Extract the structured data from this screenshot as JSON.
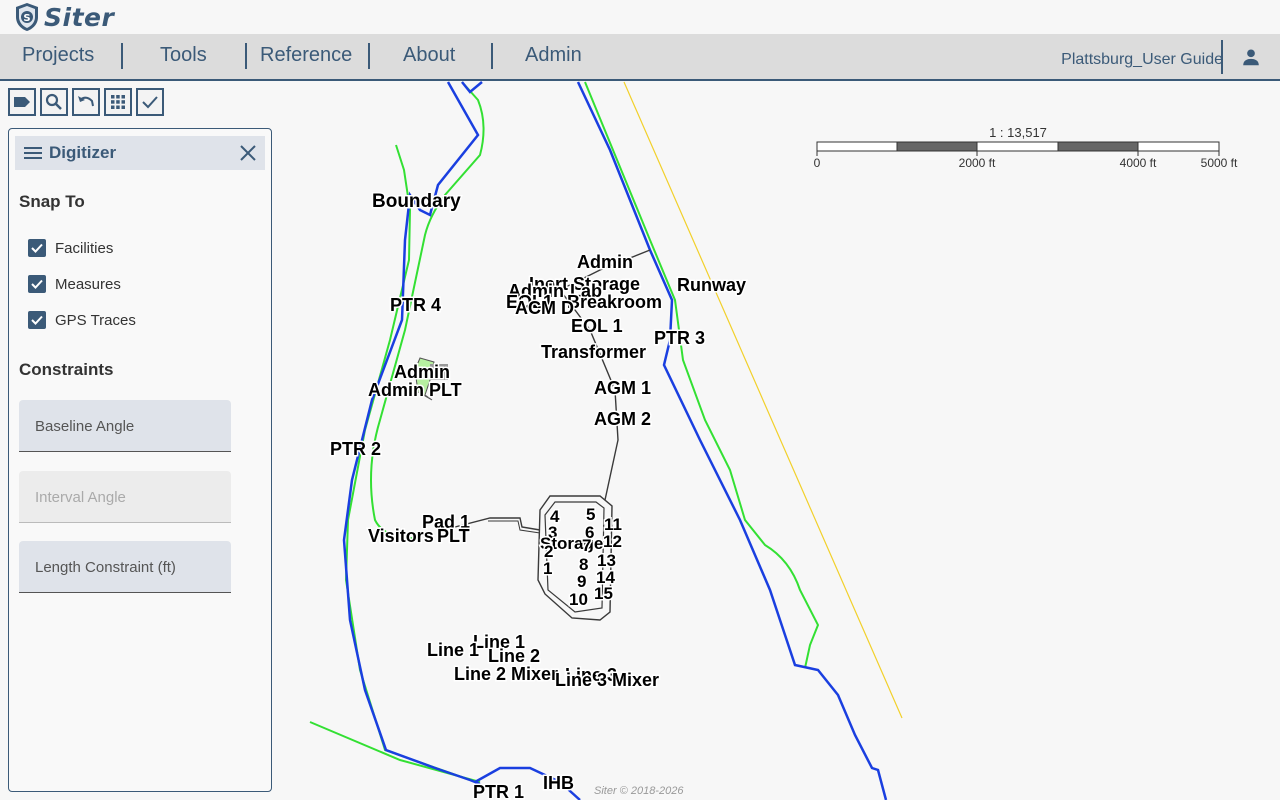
{
  "app": {
    "name": "Siter"
  },
  "nav": {
    "items": [
      "Projects",
      "Tools",
      "Reference",
      "About",
      "Admin"
    ],
    "user_guide": "Plattsburg_User Guide"
  },
  "toolbar": {
    "icons": [
      "tag-icon",
      "search-icon",
      "undo-icon",
      "grid-icon",
      "check-icon"
    ]
  },
  "digitizer": {
    "title": "Digitizer",
    "snap_title": "Snap To",
    "snap_options": [
      {
        "label": "Facilities",
        "checked": true
      },
      {
        "label": "Measures",
        "checked": true
      },
      {
        "label": "GPS Traces",
        "checked": true
      }
    ],
    "constraints_title": "Constraints",
    "fields": [
      {
        "label": "Baseline Angle",
        "state": "active"
      },
      {
        "label": "Interval Angle",
        "state": "disabled"
      },
      {
        "label": "Length Constraint (ft)",
        "state": "active"
      }
    ]
  },
  "scale": {
    "ratio": "1 : 13,517",
    "ticks": [
      "0",
      "2000 ft",
      "4000 ft",
      "5000 ft"
    ]
  },
  "map": {
    "labels": [
      "Boundary",
      "Admin",
      "Inert Storage",
      "Runway",
      "Admin",
      "Lab",
      "EOL1",
      "Breakroom",
      "ACM D",
      "PTR 4",
      "EOL 1",
      "PTR 3",
      "Transformer",
      "Admin",
      "Admin PLT",
      "AGM 1",
      "AGM 2",
      "PTR 2",
      "4",
      "5",
      "11",
      "Pad 1",
      "3",
      "6",
      "Visitors",
      "PLT",
      "Storage",
      "12",
      "2",
      "7",
      "13",
      "8",
      "1",
      "14",
      "9",
      "15",
      "10",
      "Line 1",
      "Line 1",
      "Line 2",
      "Line 3",
      "Line 2 Mixer",
      "Line 3 Mixer",
      "IHB",
      "PTR 1"
    ],
    "colors": {
      "boundary": "#1a3fe0",
      "gps": "#33e033",
      "runway": "#f2d02a",
      "facility": "#3a3a3a"
    }
  },
  "footer": {
    "copyright": "Siter © 2018-2026"
  }
}
